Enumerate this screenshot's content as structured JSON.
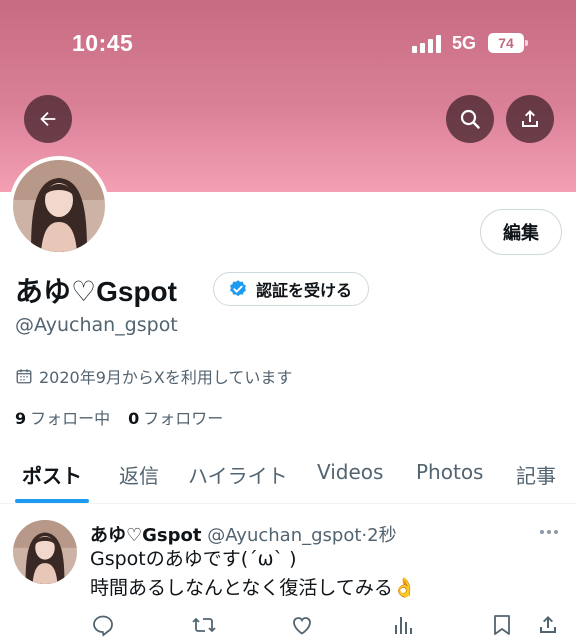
{
  "status_bar": {
    "time": "10:45",
    "network": "5G",
    "battery": "74"
  },
  "header": {
    "back_icon": "arrow-left-icon",
    "search_icon": "search-icon",
    "share_icon": "share-icon"
  },
  "profile": {
    "edit_label": "編集",
    "display_name": "あゆ♡Gspot",
    "verify_label": "認証を受ける",
    "handle": "@Ayuchan_gspot",
    "joined": "2020年9月からXを利用しています",
    "following_count": "9",
    "following_label": "フォロー中",
    "followers_count": "0",
    "followers_label": "フォロワー"
  },
  "tabs": [
    {
      "label": "ポスト",
      "active": true
    },
    {
      "label": "返信"
    },
    {
      "label": "ハイライト"
    },
    {
      "label": "Videos"
    },
    {
      "label": "Photos"
    },
    {
      "label": "記事"
    }
  ],
  "tweet": {
    "name": "あゆ♡Gspot",
    "handle": "@Ayuchan_gspot",
    "time": "2秒",
    "text": "Gspotのあゆです(ˊωˋ )\n時間あるしなんとなく復活してみる👌"
  },
  "colors": {
    "accent": "#1d9bf0",
    "banner": "#d98097",
    "muted": "#536471"
  }
}
